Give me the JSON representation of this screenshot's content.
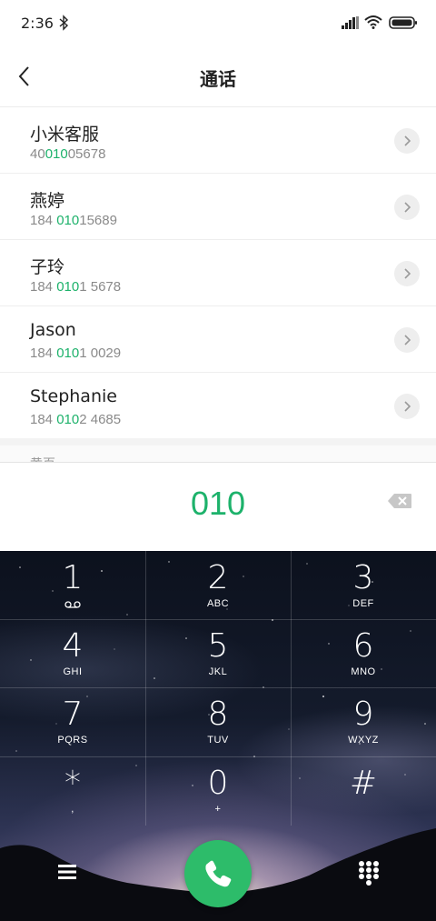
{
  "status_bar": {
    "time": "2:36"
  },
  "header": {
    "title": "通话"
  },
  "contacts": [
    {
      "name": "小米客服",
      "number_parts": [
        "40",
        "010",
        "05678"
      ]
    },
    {
      "name": "燕婷",
      "number_parts": [
        "184 ",
        "010",
        "15689"
      ]
    },
    {
      "name": "子玲",
      "number_parts": [
        "184 ",
        "010",
        "1 5678"
      ]
    },
    {
      "name": "Jason",
      "number_parts": [
        "184 ",
        "010",
        "1 0029"
      ]
    },
    {
      "name": "Stephanie",
      "number_parts": [
        "184 ",
        "010",
        "2 4685"
      ]
    }
  ],
  "section_peek": "黄页",
  "dialer": {
    "input_value": "010"
  },
  "keypad": [
    {
      "digit": "1",
      "letters": ""
    },
    {
      "digit": "2",
      "letters": "ABC"
    },
    {
      "digit": "3",
      "letters": "DEF"
    },
    {
      "digit": "4",
      "letters": "GHI"
    },
    {
      "digit": "5",
      "letters": "JKL"
    },
    {
      "digit": "6",
      "letters": "MNO"
    },
    {
      "digit": "7",
      "letters": "PQRS"
    },
    {
      "digit": "8",
      "letters": "TUV"
    },
    {
      "digit": "9",
      "letters": "WXYZ"
    },
    {
      "digit": "*",
      "letters": ","
    },
    {
      "digit": "0",
      "letters": "+"
    },
    {
      "digit": "#",
      "letters": ""
    }
  ],
  "colors": {
    "accent": "#1db26b",
    "call_button": "#2dbc6a"
  },
  "icons": [
    "bluetooth-icon",
    "signal-icon",
    "wifi-icon",
    "battery-icon",
    "back-icon",
    "chevron-right-icon",
    "backspace-icon",
    "voicemail-icon",
    "menu-icon",
    "phone-icon",
    "dialpad-icon"
  ]
}
